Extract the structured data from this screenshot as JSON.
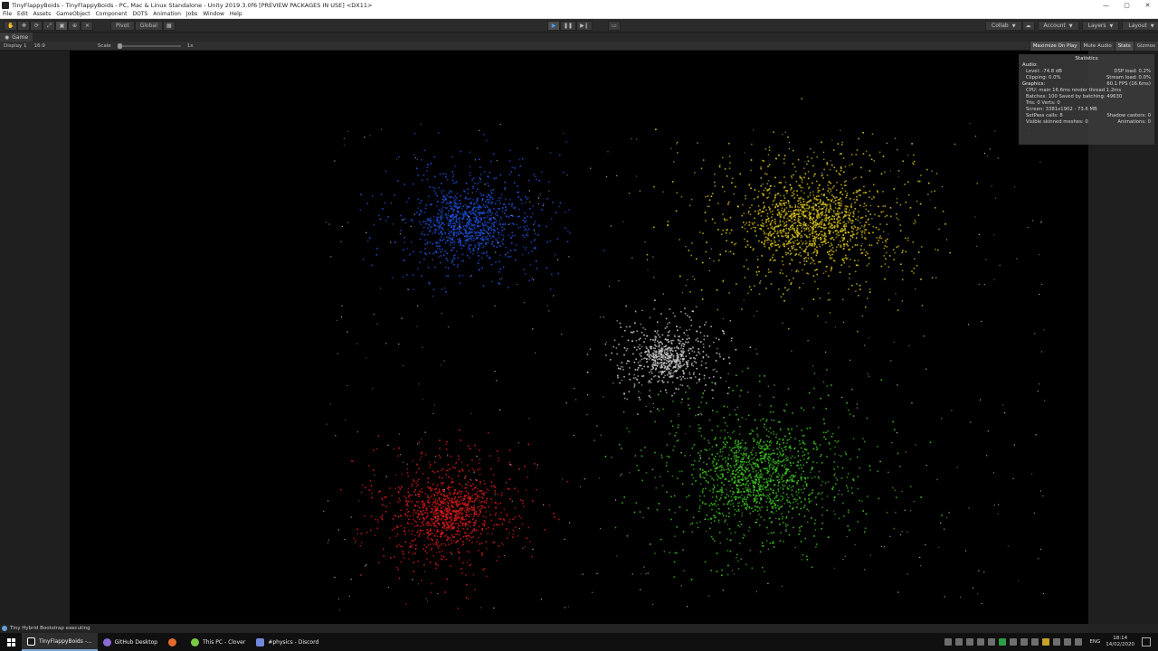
{
  "window": {
    "title": "TinyFlappyBoids - TinyFlappyBoids - PC, Mac & Linux Standalone - Unity 2019.3.0f6 [PREVIEW PACKAGES IN USE] <DX11>",
    "controls": [
      "—",
      "▢",
      "✕"
    ]
  },
  "menu": [
    "File",
    "Edit",
    "Assets",
    "GameObject",
    "Component",
    "DOTS",
    "Animation",
    "Jobs",
    "Window",
    "Help"
  ],
  "toolbar": {
    "pivot_label": "Pivot",
    "global_label": "Global",
    "collab_label": "Collab",
    "account_label": "Account",
    "layers_label": "Layers",
    "layout_label": "Layout"
  },
  "game_view": {
    "tab_label": "Game",
    "display_label": "Display 1",
    "aspect_label": "16:9",
    "scale_label": "Scale",
    "scale_value": "1x",
    "maximize_label": "Maximize On Play",
    "mute_label": "Mute Audio",
    "stats_label": "Stats",
    "gizmos_label": "Gizmos"
  },
  "stats": {
    "title": "Statistics",
    "audio_header": "Audio:",
    "level": "Level: -74.8 dB",
    "dsp_load": "DSP load: 0.2%",
    "clipping": "Clipping: 0.0%",
    "stream_load": "Stream load: 0.0%",
    "graphics_header": "Graphics:",
    "fps": "60.1 FPS (16.6ms)",
    "cpu": "CPU: main 16.6ms  render thread 1.2ms",
    "batches": "Batches: 100   Saved by batching: 49630",
    "tris": "Tris: 0   Verts: 0",
    "screen": "Screen: 3381x1902 - 73.6 MB",
    "setpass": "SetPass calls: 8",
    "shadow": "Shadow casters: 0",
    "skinned": "Visible skinned meshes: 0",
    "animations": "Animations: 0"
  },
  "status": {
    "message": "Tiny Hybrid Bootstrap executing"
  },
  "taskbar": {
    "tasks": [
      {
        "label": "TinyFlappyBoids -...",
        "color": "#ffffff"
      },
      {
        "label": "GitHub Desktop",
        "color": "#8a6bd6"
      },
      {
        "label": "",
        "color": "#e66a2c"
      },
      {
        "label": "This PC - Clover",
        "color": "#7ac943"
      },
      {
        "label": "#physics - Discord",
        "color": "#7289da"
      }
    ],
    "lang": "ENG",
    "time": "18:14",
    "date": "14/02/2020"
  },
  "scene": {
    "clusters": [
      {
        "name": "blue",
        "color": "#1f4fd6",
        "count": 1100
      },
      {
        "name": "yellow",
        "color": "#d8c21a",
        "count": 1600
      },
      {
        "name": "white",
        "color": "#c9c9c9",
        "count": 700
      },
      {
        "name": "red",
        "color": "#d11a1a",
        "count": 1200
      },
      {
        "name": "green",
        "color": "#3cc41f",
        "count": 1500
      }
    ]
  }
}
